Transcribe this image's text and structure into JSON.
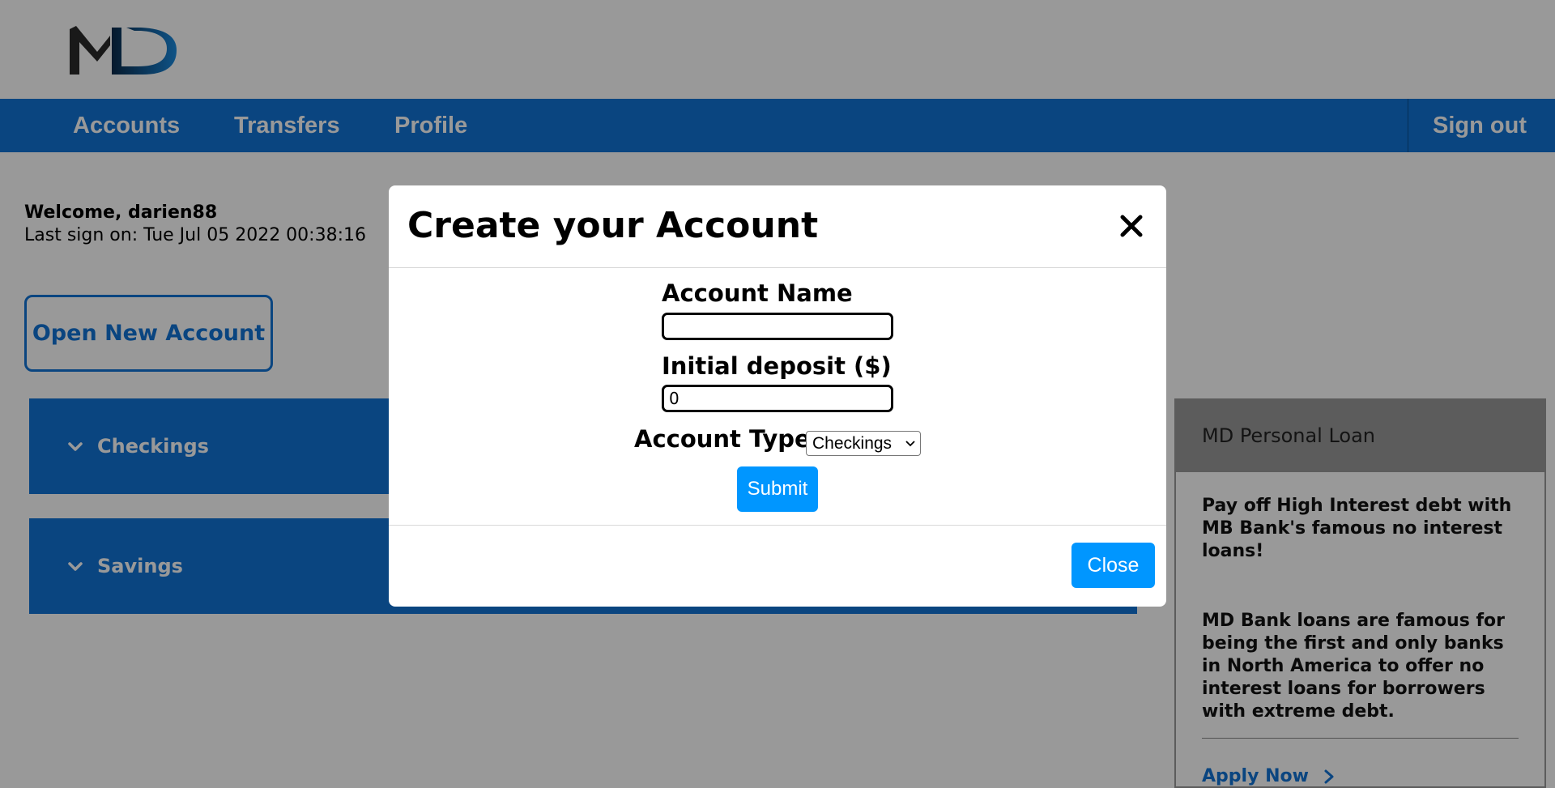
{
  "brand": {
    "logo_text": "MD"
  },
  "nav": {
    "items": [
      {
        "label": "Accounts"
      },
      {
        "label": "Transfers"
      },
      {
        "label": "Profile"
      }
    ],
    "sign_out": "Sign out"
  },
  "welcome": {
    "greeting": "Welcome, darien88",
    "last_sign_on": "Last sign on: Tue Jul 05 2022 00:38:16"
  },
  "open_account_label": "Open New Account",
  "accounts": [
    {
      "label": "Checkings"
    },
    {
      "label": "Savings"
    }
  ],
  "ad": {
    "title": "MD Personal Loan",
    "paragraph1": "Pay off High Interest debt with MB Bank's famous no interest loans!",
    "paragraph2": "MD Bank loans are famous for being the first and only banks in North America to offer no interest loans for borrowers with extreme debt.",
    "apply_label": "Apply Now"
  },
  "modal": {
    "title": "Create your Account",
    "account_name_label": "Account Name",
    "account_name_value": "",
    "deposit_label": "Initial deposit ($)",
    "deposit_value": "0",
    "account_type_label": "Account Type:",
    "account_type_selected": "Checkings",
    "submit_label": "Submit",
    "close_label": "Close"
  },
  "colors": {
    "primary": "#1273d6",
    "button": "#0096ff",
    "overlay": "rgba(0,0,0,0.4)"
  }
}
